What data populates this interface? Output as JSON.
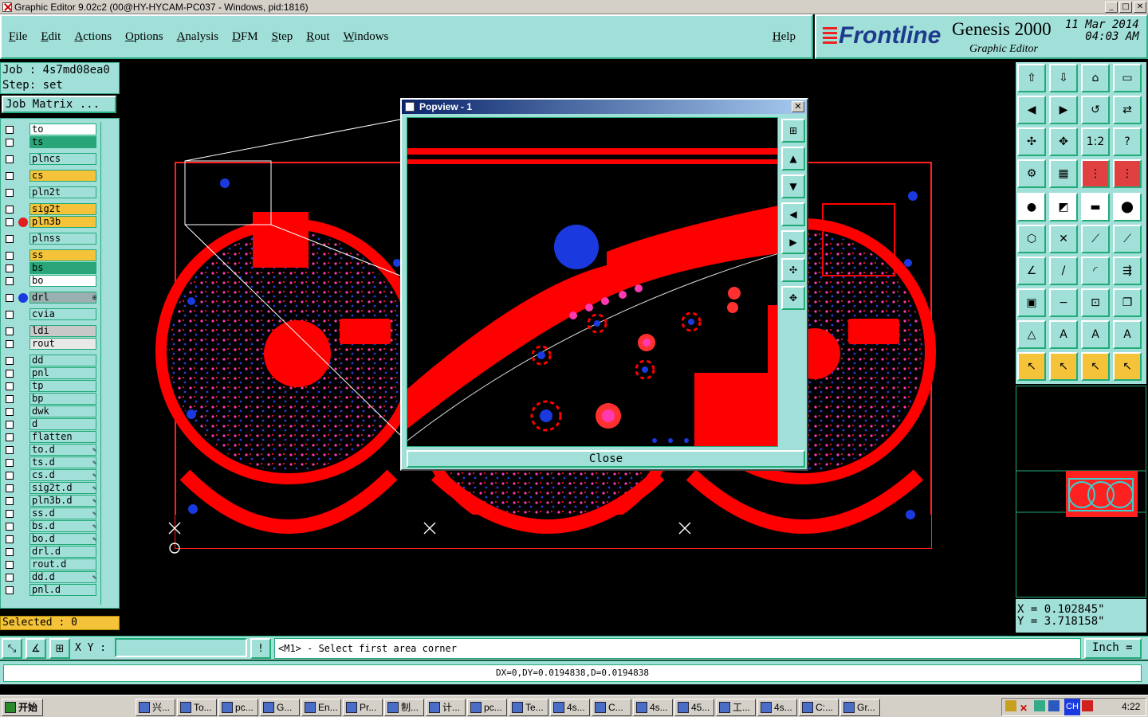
{
  "window": {
    "title": "Graphic Editor 9.02c2 (00@HY-HYCAM-PC037 - Windows, pid:1816)",
    "min": "_",
    "max": "□",
    "close": "✕"
  },
  "menu": {
    "items": [
      "File",
      "Edit",
      "Actions",
      "Options",
      "Analysis",
      "DFM",
      "Step",
      "Rout",
      "Windows"
    ],
    "help": "Help"
  },
  "brand": {
    "logo": "Frontline",
    "product": "Genesis 2000",
    "subtitle": "Graphic Editor",
    "date": "11 Mar 2014",
    "time": "04:03 AM"
  },
  "job": {
    "job_line": "Job : 4s7md08ea0",
    "step_line": "Step: set",
    "matrix_button": "Job Matrix ..."
  },
  "layers": [
    {
      "name": "to",
      "color": "#ffffff"
    },
    {
      "name": "ts",
      "color": "#2aa57a"
    },
    {
      "name": "plncs",
      "color": "#a0e0d8"
    },
    {
      "name": "cs",
      "color": "#f5c33a"
    },
    {
      "name": "pln2t",
      "color": "#a0e0d8"
    },
    {
      "name": "sig2t",
      "color": "#f5c33a"
    },
    {
      "name": "pln3b",
      "color": "#f5c33a",
      "dot": "#e02020"
    },
    {
      "name": "plnss",
      "color": "#a0e0d8"
    },
    {
      "name": "ss",
      "color": "#f5c33a"
    },
    {
      "name": "bs",
      "color": "#2aa57a"
    },
    {
      "name": "bo",
      "color": "#ffffff"
    },
    {
      "name": "drl",
      "color": "#9ab0b0",
      "dot": "#1a3adf",
      "mark": "⊞"
    },
    {
      "name": "cvia",
      "color": "#a0e0d8"
    },
    {
      "name": "ldi",
      "color": "#c8c8c8"
    },
    {
      "name": "rout",
      "color": "#e8e8e8"
    },
    {
      "name": "dd",
      "color": "#a0e0d8"
    },
    {
      "name": "pnl",
      "color": "#a0e0d8"
    },
    {
      "name": "tp",
      "color": "#a0e0d8"
    },
    {
      "name": "bp",
      "color": "#a0e0d8"
    },
    {
      "name": "dwk",
      "color": "#a0e0d8"
    },
    {
      "name": "d",
      "color": "#a0e0d8"
    },
    {
      "name": "flatten",
      "color": "#a0e0d8"
    },
    {
      "name": "to.d",
      "color": "#a0e0d8",
      "mark": "✎"
    },
    {
      "name": "ts.d",
      "color": "#a0e0d8",
      "mark": "✎"
    },
    {
      "name": "cs.d",
      "color": "#a0e0d8",
      "mark": "✎"
    },
    {
      "name": "sig2t.d",
      "color": "#a0e0d8",
      "mark": "✎"
    },
    {
      "name": "pln3b.d",
      "color": "#a0e0d8",
      "mark": "✎"
    },
    {
      "name": "ss.d",
      "color": "#a0e0d8",
      "mark": "✎"
    },
    {
      "name": "bs.d",
      "color": "#a0e0d8",
      "mark": "✎"
    },
    {
      "name": "bo.d",
      "color": "#a0e0d8",
      "mark": "✎"
    },
    {
      "name": "drl.d",
      "color": "#a0e0d8"
    },
    {
      "name": "rout.d",
      "color": "#a0e0d8"
    },
    {
      "name": "dd.d",
      "color": "#a0e0d8",
      "mark": "✎"
    },
    {
      "name": "pnl.d",
      "color": "#a0e0d8"
    }
  ],
  "selected": "Selected : 0",
  "popview": {
    "title": "Popview - 1",
    "close_button": "Close"
  },
  "coords": {
    "x": "X = 0.102845\"",
    "y": "Y = 3.718158\""
  },
  "bottom": {
    "xy_label": "X Y :",
    "xy_value": "",
    "prompt": "<M1> - Select first area corner",
    "units": "Inch ="
  },
  "status": "DX=0,DY=0.0194838,D=0.0194838",
  "taskbar": {
    "start": "开始",
    "items": [
      "兴...",
      "To...",
      "pc...",
      "G...",
      "En...",
      "Pr...",
      "制...",
      "计...",
      "pc...",
      "Te...",
      "4s...",
      "C...",
      "4s...",
      "45...",
      "工...",
      "4s...",
      "C:...",
      "Gr..."
    ],
    "tray_lang": "CH",
    "clock": "4:22"
  },
  "colors": {
    "panel": "#a0e0d8",
    "copper": "#ff0000",
    "drill": "#1a3adf",
    "via": "#ff3ab0"
  }
}
